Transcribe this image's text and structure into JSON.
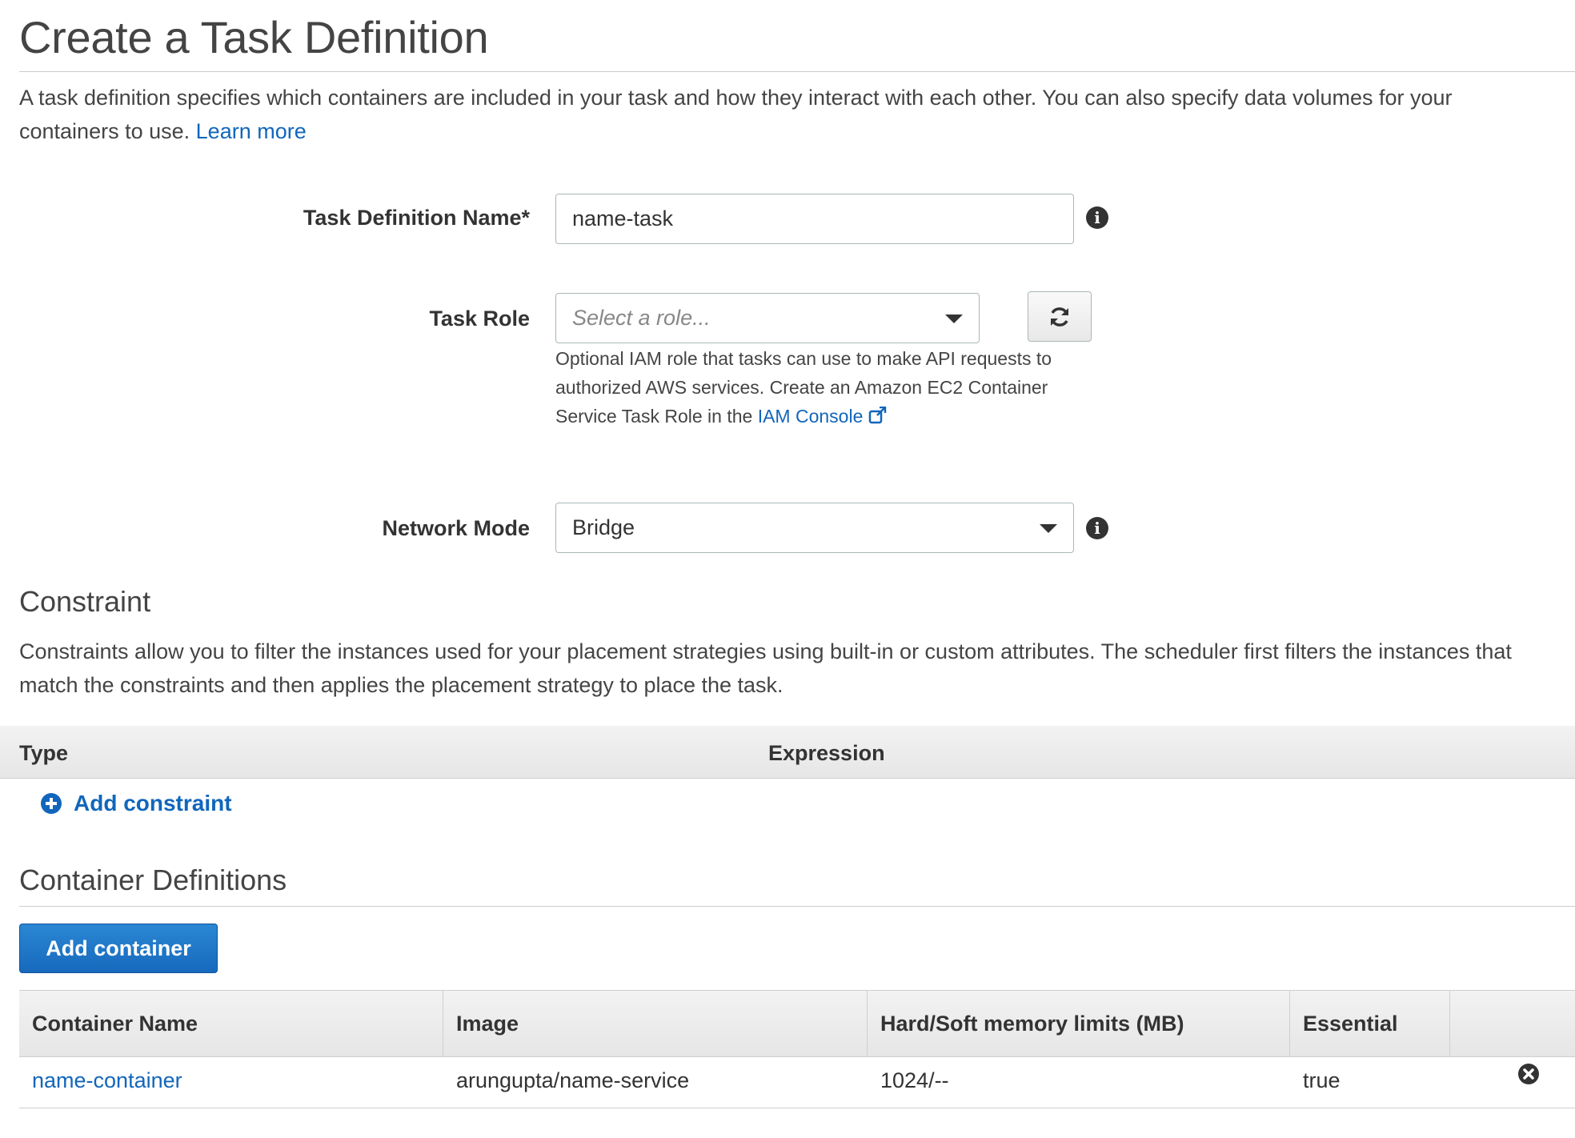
{
  "page": {
    "title": "Create a Task Definition",
    "intro": "A task definition specifies which containers are included in your task and how they interact with each other. You can also specify data volumes for your containers to use.",
    "learn_more": "Learn more"
  },
  "form": {
    "task_def_name": {
      "label": "Task Definition Name*",
      "value": "name-task"
    },
    "task_role": {
      "label": "Task Role",
      "placeholder": "Select a role...",
      "help": "Optional IAM role that tasks can use to make API requests to authorized AWS services. Create an Amazon EC2 Container Service Task Role in the",
      "help_link": "IAM Console"
    },
    "network_mode": {
      "label": "Network Mode",
      "value": "Bridge"
    }
  },
  "constraint": {
    "heading": "Constraint",
    "description": "Constraints allow you to filter the instances used for your placement strategies using built-in or custom attributes. The scheduler first filters the instances that match the constraints and then applies the placement strategy to place the task.",
    "columns": [
      "Type",
      "Expression"
    ],
    "add_label": "Add constraint"
  },
  "containers": {
    "heading": "Container Definitions",
    "add_button": "Add container",
    "columns": [
      "Container Name",
      "Image",
      "Hard/Soft memory limits (MB)",
      "Essential"
    ],
    "rows": [
      {
        "name": "name-container",
        "image": "arungupta/name-service",
        "memory": "1024/--",
        "essential": "true"
      }
    ]
  },
  "icons": {
    "info": "info-icon",
    "refresh": "refresh-icon",
    "external": "external-link-icon",
    "add": "plus-circle-icon",
    "remove": "remove-circle-icon",
    "dropdown": "chevron-down-icon"
  },
  "colors": {
    "link": "#1166bb",
    "primary": "#1769bd"
  }
}
